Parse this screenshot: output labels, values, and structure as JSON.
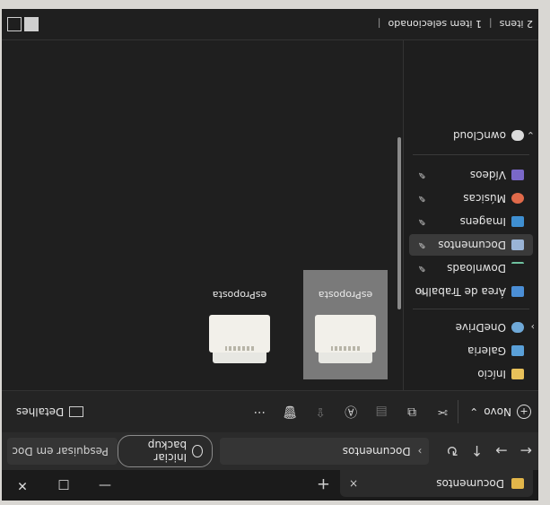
{
  "tab": {
    "title": "Documentos",
    "close": "×",
    "new": "+"
  },
  "window": {
    "minimize": "—",
    "maximize": "□",
    "close": "✕"
  },
  "nav": {
    "back": "←",
    "forward": "→",
    "up": "↑",
    "refresh": "↻"
  },
  "breadcrumb": {
    "separator": "›",
    "current": "Documentos"
  },
  "backup_label": "Iniciar backup",
  "search_placeholder": "Pesquisar em Doc",
  "toolbar": {
    "new_label": "Novo",
    "new_chevron": "⌄",
    "details_label": "Detalhes",
    "more": "···",
    "icons": [
      "cut-icon",
      "copy-icon",
      "paste-icon",
      "rename-icon",
      "share-icon",
      "delete-icon"
    ]
  },
  "sidebar": {
    "home": "Início",
    "gallery": "Galeria",
    "onedrive": "OneDrive",
    "pinned": [
      {
        "label": "Área de Trabalho"
      },
      {
        "label": "Downloads"
      },
      {
        "label": "Documentos"
      },
      {
        "label": "Imagens"
      },
      {
        "label": "Músicas"
      },
      {
        "label": "Vídeos"
      }
    ],
    "owncloud": "ownCloud",
    "chevron": "›",
    "expand": "⌄",
    "pin": "✎"
  },
  "files": [
    {
      "name": "esProposta",
      "selected": true
    },
    {
      "name": "esProposta",
      "selected": false
    }
  ],
  "status": {
    "count": "2 itens",
    "selected": "1 item selecionado",
    "sep": "|"
  },
  "colors": {
    "folder": "#e2b64a",
    "accent": "#0a84ff"
  }
}
